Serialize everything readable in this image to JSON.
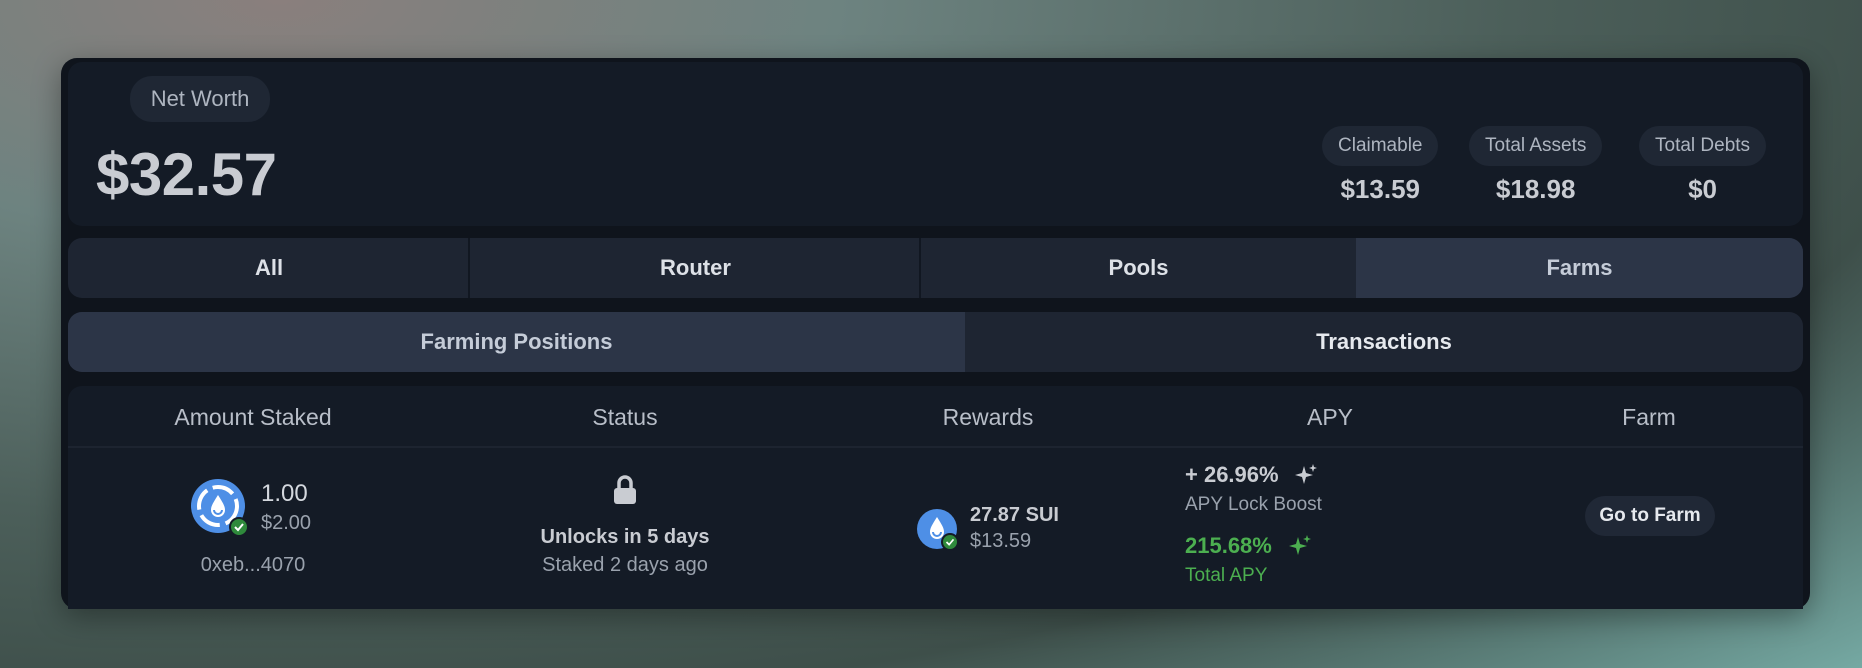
{
  "net_worth": {
    "label": "Net Worth",
    "value": "$32.57"
  },
  "stats": [
    {
      "label": "Claimable",
      "value": "$13.59"
    },
    {
      "label": "Total Assets",
      "value": "$18.98"
    },
    {
      "label": "Total Debts",
      "value": "$0"
    }
  ],
  "tabs": [
    "All",
    "Router",
    "Pools",
    "Farms"
  ],
  "active_tab": "Farms",
  "subtabs": [
    "Farming Positions",
    "Transactions"
  ],
  "active_subtab": "Farming Positions",
  "table": {
    "headers": [
      "Amount Staked",
      "Status",
      "Rewards",
      "APY",
      "Farm"
    ],
    "row": {
      "amount": "1.00",
      "amount_usd": "$2.00",
      "address": "0xeb...4070",
      "status_title": "Unlocks in 5 days",
      "status_sub": "Staked 2 days ago",
      "reward_amount": "27.87 SUI",
      "reward_usd": "$13.59",
      "apy_boost": "+ 26.96%",
      "apy_boost_label": "APY Lock Boost",
      "apy_total": "215.68%",
      "apy_total_label": "Total APY",
      "farm_button": "Go to Farm"
    }
  },
  "icons": [
    "lock-icon",
    "sparkle-icon",
    "sui-token-icon",
    "verified-check-icon"
  ],
  "colors": {
    "accent_green": "#4caf50",
    "token_blue": "#4e8fe6"
  }
}
